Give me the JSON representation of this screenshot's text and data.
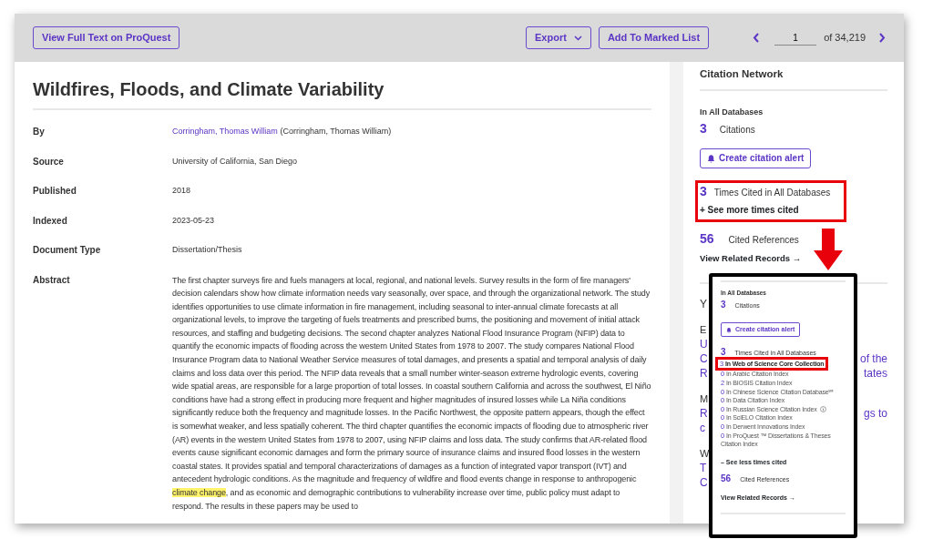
{
  "toolbar": {
    "full_text_button": "View Full Text on ProQuest",
    "export_button": "Export",
    "marked_list_button": "Add To Marked List",
    "pager": {
      "page": "1",
      "total": "of 34,219"
    }
  },
  "record": {
    "title": "Wildfires, Floods, and Climate Variability",
    "fields": [
      {
        "label": "By",
        "kind": "author",
        "link": "Corringham, Thomas William",
        "text": "(Corringham, Thomas William)"
      },
      {
        "label": "Source",
        "kind": "text",
        "value": "University of California, San Diego"
      },
      {
        "label": "Published",
        "kind": "text",
        "value": "2018"
      },
      {
        "label": "Indexed",
        "kind": "text",
        "value": "2023-05-23"
      },
      {
        "label": "Document Type",
        "kind": "text",
        "value": "Dissertation/Thesis"
      },
      {
        "label": "Abstract",
        "kind": "abstract",
        "segments": [
          {
            "text": "The first chapter surveys fire and fuels managers at local, regional, and national levels. Survey results in the form of fire managers' decision calendars show how climate information needs vary seasonally, over space, and through the organizational network. The study identifies opportunities to use climate information in fire management, including seasonal to inter-annual climate forecasts at all organizational levels, to improve the targeting of fuels treatments and prescribed burns, the positioning and movement of initial attack resources, and staffing and budgeting decisions. The second chapter analyzes National Flood Insurance Program (NFIP) data to quantify the economic impacts of flooding across the western United States from 1978 to 2007. The study compares National Flood Insurance Program data to National Weather Service measures of total damages, and presents a spatial and temporal analysis of daily claims and loss data over this period. The NFIP data reveals that a small number winter-season extreme hydrologic events, covering wide spatial areas, are responsible for a large proportion of total losses. In coastal southern California and across the southwest, El Niño conditions have had a strong effect in producing more frequent and higher magnitudes of insured losses while La Niña conditions significantly reduce both the frequency and magnitude losses. In the Pacific Northwest, the opposite pattern appears, though the effect is somewhat weaker, and less spatially coherent. The third chapter quantifies the economic impacts of flooding due to atmospheric river (AR) events in the western United States from 1978 to 2007, using NFIP claims and loss data. The study confirms that AR-related flood events cause significant economic damages and form the primary source of insurance claims and insured flood losses in the western coastal states. It provides spatial and temporal characterizations of damages as a function of integrated vapor transport (IVT) and antecedent hydrologic conditions. As the magnitude and frequency of wildfire and flood events change in response to anthropogenic ",
            "highlighted": false
          },
          {
            "text": "climate change",
            "highlighted": true
          },
          {
            "text": ", and as economic and demographic contributions to vulnerability increase over time, public policy must adapt to respond. The results in these papers may be used to",
            "highlighted": false
          }
        ]
      }
    ]
  },
  "citation_network": {
    "title": "Citation Network",
    "scope": "In All Databases",
    "citations": {
      "count": "3",
      "label": "Citations"
    },
    "alert_button": "Create citation alert",
    "times_cited": {
      "count": "3",
      "label": "Times Cited in All Databases",
      "highlighted": true
    },
    "toggle": {
      "symbol": "+",
      "label": "See more times cited"
    },
    "cited_references": {
      "count": "56",
      "label": "Cited References"
    },
    "related_link": "View Related Records →",
    "hidden_rows": [
      {
        "left": "Y",
        "kind": "heading"
      },
      {
        "left": "E",
        "kind": "label"
      },
      {
        "left": "U",
        "kind": "link"
      },
      {
        "left": "C",
        "right": "of the",
        "kind": "link"
      },
      {
        "left": "R",
        "right": "tates",
        "kind": "link"
      },
      {
        "left": "M",
        "kind": "label"
      },
      {
        "left": "R",
        "right": "gs to",
        "kind": "link"
      },
      {
        "left": "c",
        "kind": "link"
      },
      {
        "left": "W",
        "kind": "label"
      },
      {
        "left": "T",
        "kind": "link"
      },
      {
        "left": "C",
        "kind": "link"
      }
    ]
  },
  "callout": {
    "scope": "In All Databases",
    "citations": {
      "count": "3",
      "label": "Citations"
    },
    "alert_button": "Create citation alert",
    "times_cited": {
      "count": "3",
      "label": "Times Cited in All Databases"
    },
    "breakdown": [
      {
        "count": "3",
        "label": "In Web of Science Core Collection",
        "emphasized": true,
        "info": false
      },
      {
        "count": "0",
        "label": "In Arabic Citation Index",
        "emphasized": false,
        "info": false
      },
      {
        "count": "2",
        "label": "In BIOSIS Citation Index",
        "emphasized": false,
        "info": false
      },
      {
        "count": "0",
        "label": "In Chinese Science Citation Database℠",
        "emphasized": false,
        "info": false
      },
      {
        "count": "0",
        "label": "In Data Citation Index",
        "emphasized": false,
        "info": false
      },
      {
        "count": "0",
        "label": "In Russian Science Citation Index",
        "emphasized": false,
        "info": true
      },
      {
        "count": "0",
        "label": "In SciELO Citation Index",
        "emphasized": false,
        "info": false
      },
      {
        "count": "0",
        "label": "In Derwent Innovations Index",
        "emphasized": false,
        "info": false
      },
      {
        "count": "0",
        "label": "In ProQuest ™ Dissertations & Theses Citation Index",
        "emphasized": false,
        "info": false
      }
    ],
    "toggle": {
      "symbol": "–",
      "label": "See less times cited"
    },
    "cited_references": {
      "count": "56",
      "label": "Cited References"
    },
    "related_link": "View Related Records →"
  }
}
